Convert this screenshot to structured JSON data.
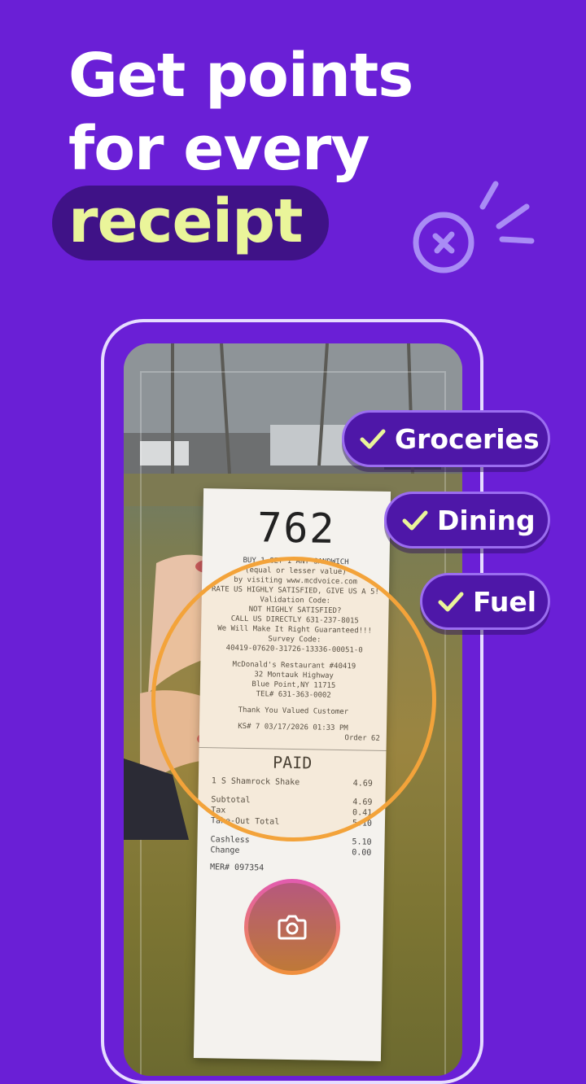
{
  "headline": {
    "line1": "Get points",
    "line2": "for every",
    "highlight": "receipt"
  },
  "tags": [
    {
      "label": "Groceries"
    },
    {
      "label": "Dining"
    },
    {
      "label": "Fuel"
    }
  ],
  "receipt": {
    "order_number": "762",
    "lines": [
      "BUY 1 GET 1 ANY SANDWICH",
      "(equal or lesser value)",
      "by visiting www.mcdvoice.com",
      "RATE US HIGHLY SATISFIED, GIVE US A 5!",
      "Validation Code:",
      "NOT HIGHLY SATISFIED?",
      "CALL US DIRECTLY 631-237-8015",
      "We Will Make It Right Guaranteed!!!",
      "Survey Code:",
      "40419-07620-31726-13336-00051-0",
      "McDonald's Restaurant #40419",
      "32 Montauk Highway",
      "Blue Point,NY 11715",
      "TEL# 631-363-0002",
      "Thank You Valued Customer",
      "KS# 7        03/17/2026 01:33 PM",
      "Order 62"
    ],
    "paid_label": "PAID",
    "items": [
      {
        "name": "1 S Shamrock Shake",
        "amount": "4.69"
      },
      {
        "name": "Subtotal",
        "amount": "4.69"
      },
      {
        "name": "Tax",
        "amount": "0.41"
      },
      {
        "name": "Take-Out Total",
        "amount": "5.10"
      },
      {
        "name": "Cashless",
        "amount": "5.10"
      },
      {
        "name": "Change",
        "amount": "0.00"
      },
      {
        "name": "MER# 097354",
        "amount": ""
      }
    ]
  },
  "icons": {
    "coin": "coin-x-icon",
    "camera": "camera-icon",
    "check": "check-icon"
  },
  "colors": {
    "background": "#6a1fd6",
    "highlight_bg": "#3f1287",
    "highlight_text": "#eaf59a",
    "tag_bg": "#4e17a8",
    "focus_ring": "#f3a33a"
  }
}
